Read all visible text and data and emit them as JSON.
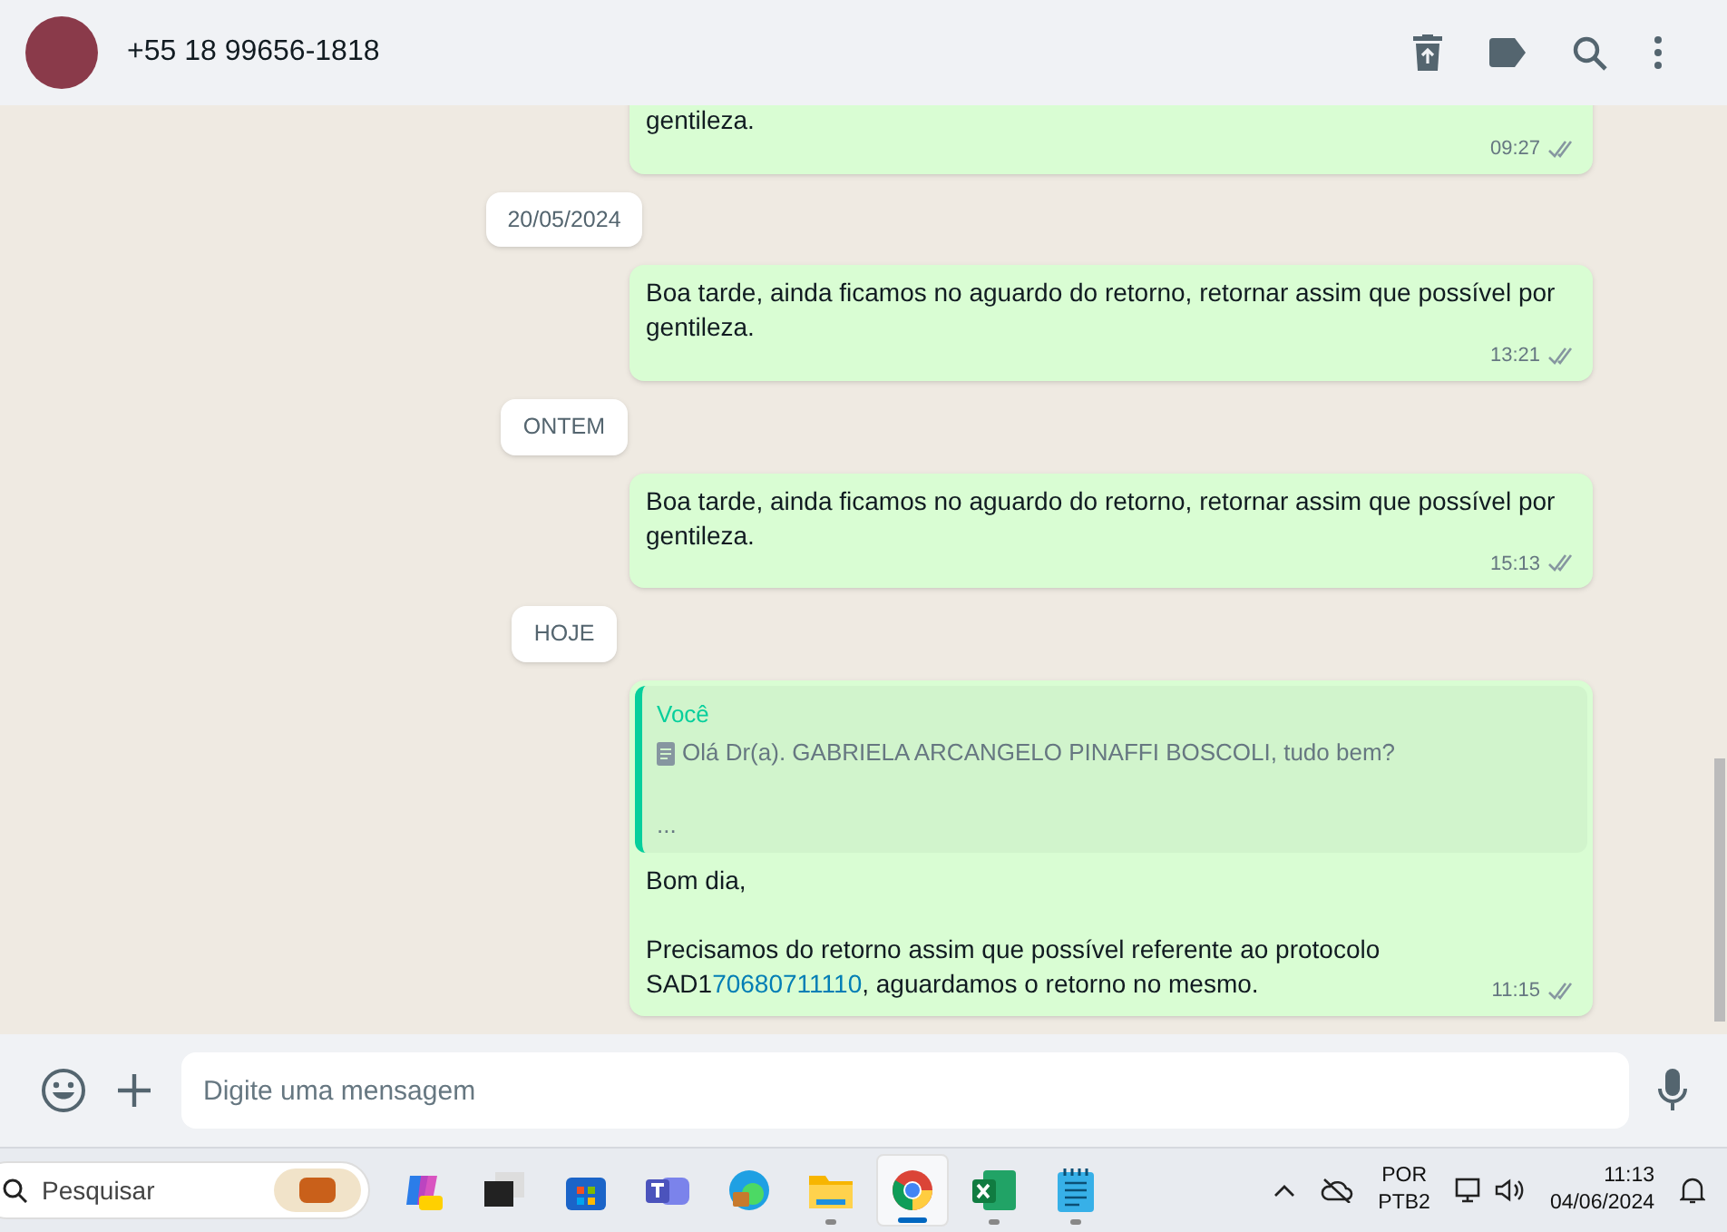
{
  "header": {
    "contact": "+55 18 99656-1818"
  },
  "messages": [
    {
      "kind": "text",
      "lines": [
        "gentileza."
      ],
      "time": "09:27",
      "read": true,
      "clipped": true
    },
    {
      "kind": "date",
      "label": "20/05/2024"
    },
    {
      "kind": "text",
      "lines": [
        "Boa tarde, ainda ficamos no aguardo do retorno, retornar assim que possível por gentileza."
      ],
      "time": "13:21",
      "read": true,
      "clipped": false
    },
    {
      "kind": "date",
      "label": "ONTEM"
    },
    {
      "kind": "text",
      "lines": [
        "Boa tarde, ainda ficamos no aguardo do retorno, retornar assim que possível por gentileza."
      ],
      "time": "15:13",
      "read": true,
      "clipped": false
    },
    {
      "kind": "date",
      "label": "HOJE"
    },
    {
      "kind": "reply",
      "quote_author": "Você",
      "quote_text": "Olá Dr(a). GABRIELA ARCANGELO PINAFFI BOSCOLI, tudo bem?",
      "quote_more": "...",
      "lines": [
        "Bom dia,"
      ],
      "body_before": "Precisamos do retorno assim que possível referente ao protocolo SAD1",
      "link": "70680711110",
      "body_after": ", aguardamos o retorno no mesmo.",
      "time": "11:15",
      "read": true
    }
  ],
  "composer": {
    "placeholder": "Digite uma mensagem"
  },
  "taskbar": {
    "search_placeholder": "Pesquisar",
    "apps": [
      {
        "kind": "copilot",
        "running": false,
        "selected": false
      },
      {
        "kind": "taskview",
        "running": false,
        "selected": false
      },
      {
        "kind": "store",
        "running": false,
        "selected": false
      },
      {
        "kind": "teams",
        "running": false,
        "selected": false
      },
      {
        "kind": "edge",
        "running": false,
        "selected": false
      },
      {
        "kind": "explorer",
        "running": true,
        "selected": false
      },
      {
        "kind": "chrome",
        "running": true,
        "selected": true
      },
      {
        "kind": "excel",
        "running": true,
        "selected": false
      },
      {
        "kind": "notepad",
        "running": true,
        "selected": false
      }
    ],
    "language": [
      "POR",
      "PTB2"
    ],
    "time": "11:13",
    "date": "04/06/2024"
  }
}
